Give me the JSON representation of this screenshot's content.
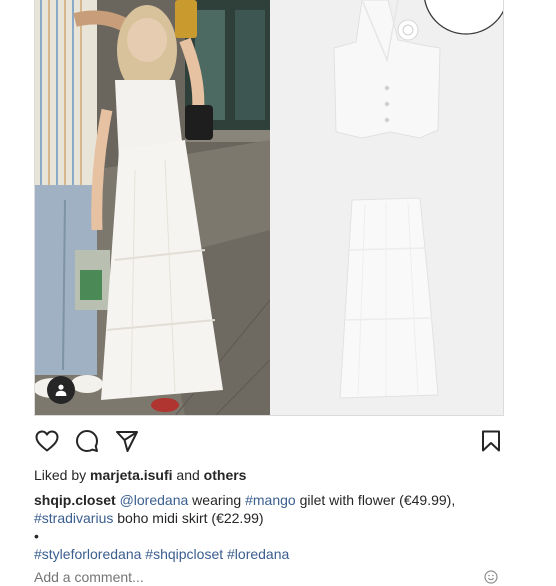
{
  "post": {
    "liked_by_prefix": "Liked by",
    "liked_by_user": "marjeta.isufi",
    "liked_by_middle": "and",
    "liked_by_others": "others",
    "caption": {
      "username": "shqip.closet",
      "mention": "@loredana",
      "text1": "wearing",
      "tag_mango": "#mango",
      "text2": "gilet with flower (€49.99),",
      "tag_stradivarius": "#stradivarius",
      "text3": "boho midi skirt (€22.99)",
      "dot": "•",
      "hashtags": [
        "#styleforloredana",
        "#shqipcloset",
        "#loredana"
      ]
    },
    "add_comment_placeholder": "Add a comment..."
  },
  "icons": {
    "like": "heart-icon",
    "comment": "comment-bubble-icon",
    "share": "paper-plane-icon",
    "save": "bookmark-icon",
    "user_tag": "person-icon",
    "emoji": "smiley-icon"
  },
  "colors": {
    "link": "#3a5e8f",
    "text": "#262626",
    "muted": "#8e8e8e",
    "border": "#dbdbdb"
  }
}
